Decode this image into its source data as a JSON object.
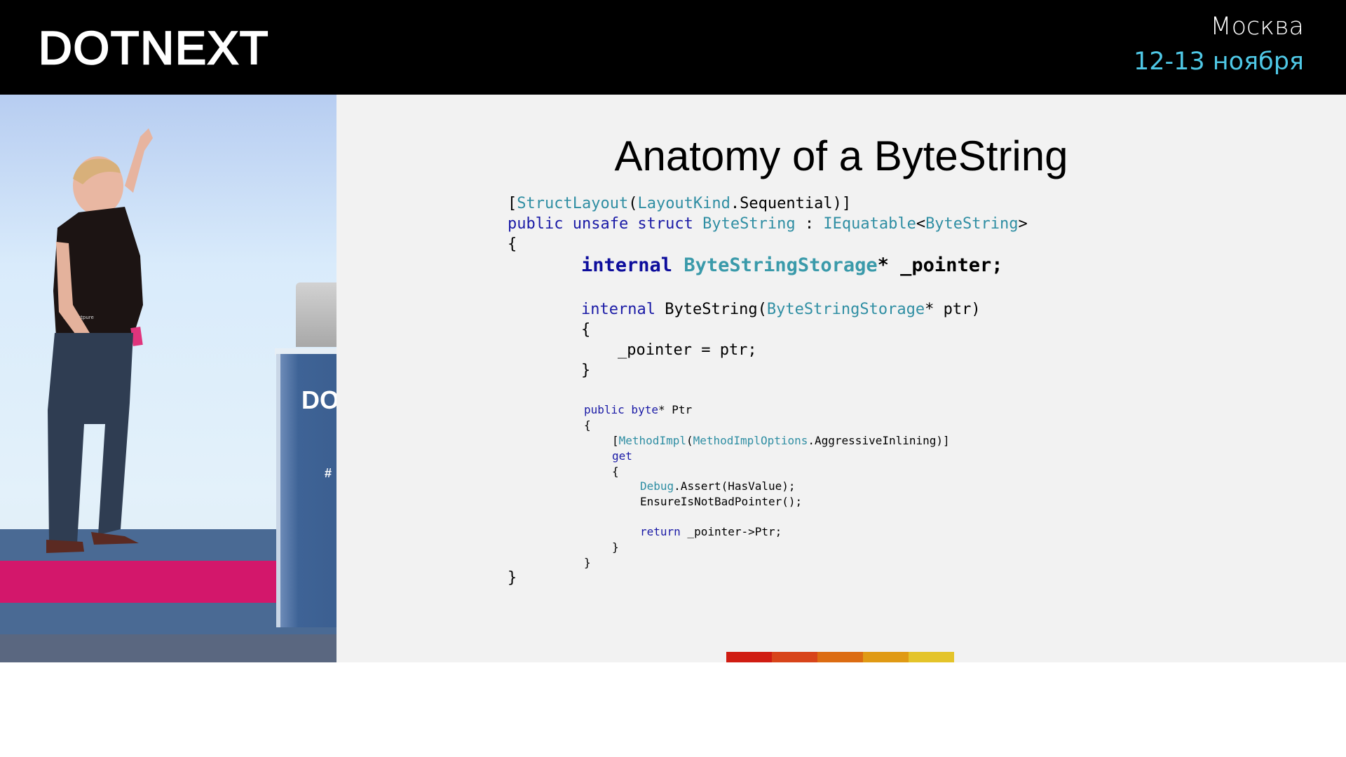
{
  "header": {
    "logo": "DOTNEXT",
    "city": "Москва",
    "dates": "12-13 ноября"
  },
  "video": {
    "podium_text": "DO",
    "podium_hashtag": "#",
    "shirt_text": "connectpure"
  },
  "slide": {
    "title": "Anatomy of a ByteString",
    "code": {
      "l1": {
        "b1": "[",
        "t1": "StructLayout",
        "b2": "(",
        "t2": "LayoutKind",
        "rest": ".Sequential)]"
      },
      "l2": {
        "k1": "public unsafe struct",
        "sp1": " ",
        "t1": "ByteString",
        "mid": " : ",
        "t2": "IEquatable",
        "lt": "<",
        "t3": "ByteString",
        "gt": ">"
      },
      "l3": "{",
      "l4": {
        "k1": "internal",
        "sp": " ",
        "t1": "ByteStringStorage",
        "rest": "* _pointer;"
      },
      "l5": {
        "k1": "internal",
        "mid": " ByteString(",
        "t1": "ByteStringStorage",
        "rest": "* ptr)"
      },
      "l6": "{",
      "l7": "_pointer = ptr;",
      "l8": "}",
      "l9": {
        "k1": "public byte",
        "rest": "* Ptr"
      },
      "l10": "{",
      "l11": {
        "b1": "[",
        "t1": "MethodImpl",
        "b2": "(",
        "t2": "MethodImplOptions",
        "rest": ".AggressiveInlining)]"
      },
      "l12": "get",
      "l13": "{",
      "l14": {
        "t1": "Debug",
        "rest": ".Assert(HasValue);"
      },
      "l15": "EnsureIsNotBadPointer();",
      "l16": {
        "k1": "return",
        "rest": " _pointer->Ptr;"
      },
      "l17": "}",
      "l18": "}",
      "l19": "}"
    },
    "accent_colors": [
      "#d01c12",
      "#d8441a",
      "#dc6c12",
      "#e09a14",
      "#e4c42a"
    ]
  }
}
